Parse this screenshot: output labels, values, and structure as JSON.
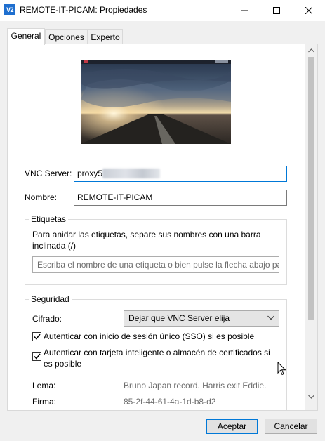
{
  "window": {
    "app_icon_text": "V2",
    "title": "REMOTE-IT-PICAM: Propiedades",
    "icons": [
      "minimize-icon",
      "maximize-icon",
      "close-icon"
    ]
  },
  "tabs": [
    {
      "label": "General",
      "active": true
    },
    {
      "label": "Opciones",
      "active": false
    },
    {
      "label": "Experto",
      "active": false
    }
  ],
  "fields": {
    "vnc_server_label": "VNC Server:",
    "vnc_server_value": "proxy5",
    "name_label": "Nombre:",
    "name_value": "REMOTE-IT-PICAM"
  },
  "tags": {
    "title": "Etiquetas",
    "hint": "Para anidar las etiquetas, separe sus nombres con una barra inclinada (/)",
    "placeholder": "Escriba el nombre de una etiqueta o bien pulse la flecha abajo par"
  },
  "security": {
    "title": "Seguridad",
    "encryption_label": "Cifrado:",
    "encryption_value": "Dejar que VNC Server elija",
    "sso_label": "Autenticar con inicio de sesión único (SSO) si es posible",
    "sso_checked": true,
    "smartcard_label": "Autenticar con tarjeta inteligente o almacén de certificados si es posible",
    "smartcard_checked": true,
    "motto_label": "Lema:",
    "motto_value": "Bruno Japan record. Harris exit Eddie.",
    "signature_label": "Firma:",
    "signature_value": "85-2f-44-61-4a-1d-b8-d2"
  },
  "buttons": {
    "ok": "Aceptar",
    "cancel": "Cancelar"
  }
}
